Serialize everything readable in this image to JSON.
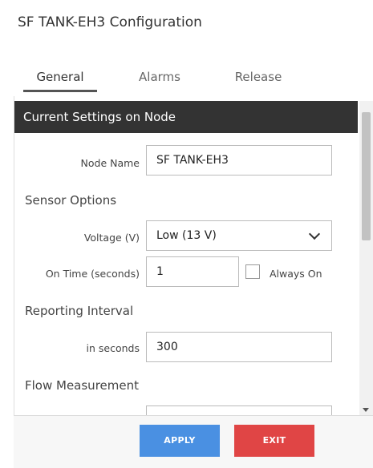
{
  "window": {
    "title": "SF TANK-EH3 Configuration"
  },
  "tabs": [
    {
      "label": "General",
      "active": true
    },
    {
      "label": "Alarms",
      "active": false
    },
    {
      "label": "Release",
      "active": false
    }
  ],
  "panel": {
    "header": "Current Settings on Node",
    "node_name": {
      "label": "Node Name",
      "value": "SF TANK-EH3"
    },
    "sensor_options": {
      "heading": "Sensor Options",
      "voltage": {
        "label": "Voltage (V)",
        "selected": "Low (13 V)"
      },
      "on_time": {
        "label": "On Time (seconds)",
        "value": "1"
      },
      "always_on": {
        "label": "Always On",
        "checked": false
      }
    },
    "reporting_interval": {
      "heading": "Reporting Interval",
      "seconds": {
        "label": "in seconds",
        "value": "300"
      }
    },
    "flow_measurement": {
      "heading": "Flow Measurement"
    }
  },
  "footer": {
    "apply_label": "APPLY",
    "exit_label": "EXIT"
  },
  "colors": {
    "header_bg": "#333333",
    "apply": "#4a90e2",
    "exit": "#e04545"
  }
}
